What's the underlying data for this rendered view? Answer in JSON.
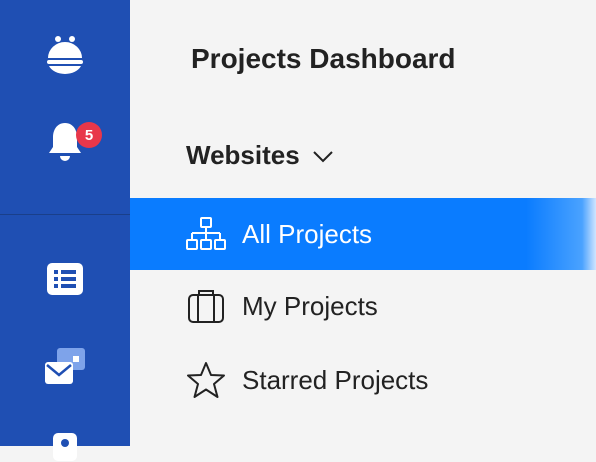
{
  "rail": {
    "icons": [
      "app-logo-icon",
      "bell-icon",
      "list-icon",
      "messages-icon",
      "user-icon"
    ],
    "notification_count": "5",
    "colors": {
      "rail_background": "#1f4fb3",
      "badge": "#e8374a"
    }
  },
  "panel": {
    "title": "Projects Dashboard",
    "section": {
      "label": "Websites",
      "icon": "chevron-down-icon"
    },
    "items": [
      {
        "label": "All Projects",
        "icon": "sitemap-icon",
        "active": true
      },
      {
        "label": "My Projects",
        "icon": "briefcase-icon",
        "active": false
      },
      {
        "label": "Starred Projects",
        "icon": "star-icon",
        "active": false
      }
    ],
    "colors": {
      "active_background": "#0a7cff",
      "active_text": "#ffffff",
      "text": "#222222",
      "panel_background": "#f4f4f4"
    }
  }
}
